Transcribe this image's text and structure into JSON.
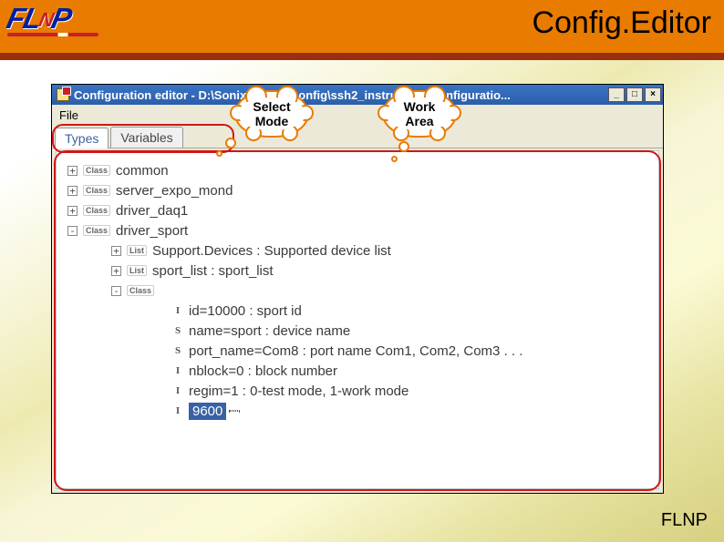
{
  "page": {
    "title": "Config.Editor",
    "footer": "FLNP",
    "logo_letters": {
      "f": "F",
      "l": "L",
      "n": "N",
      "p": "P"
    }
  },
  "callouts": {
    "select_mode": {
      "line1": "Select",
      "line2": "Mode"
    },
    "work_area": {
      "line1": "Work",
      "line2": "Area"
    }
  },
  "window": {
    "title": "Configuration editor - D:\\SonixSystem\\config\\ssh2_instrument_configuratio...",
    "controls": {
      "minimize": "_",
      "maximize": "□",
      "close": "×"
    },
    "menu": {
      "file": "File"
    },
    "tabs": {
      "types": "Types",
      "variables": "Variables"
    }
  },
  "tree": {
    "nodes": [
      {
        "level": 0,
        "expander": "+",
        "tag": "Class",
        "label": "common"
      },
      {
        "level": 0,
        "expander": "+",
        "tag": "Class",
        "label": "server_expo_mond"
      },
      {
        "level": 0,
        "expander": "+",
        "tag": "Class",
        "label": "driver_daq1"
      },
      {
        "level": 0,
        "expander": "-",
        "tag": "Class",
        "label": "driver_sport"
      },
      {
        "level": 1,
        "expander": "+",
        "tag": "List",
        "label": "Support.Devices : Supported device list"
      },
      {
        "level": 1,
        "expander": "+",
        "tag": "List",
        "label": "sport_list : sport_list"
      },
      {
        "level": 1,
        "expander": "-",
        "tag": "Class",
        "label": ""
      },
      {
        "level": 2,
        "expander": "",
        "kind": "I",
        "label": "id=10000 : sport id"
      },
      {
        "level": 2,
        "expander": "",
        "kind": "S",
        "label": "name=sport : device name"
      },
      {
        "level": 2,
        "expander": "",
        "kind": "S",
        "label": "port_name=Com8 : port name  Com1, Com2, Com3  . . ."
      },
      {
        "level": 2,
        "expander": "",
        "kind": "I",
        "label": "nblock=0 : block number"
      },
      {
        "level": 2,
        "expander": "",
        "kind": "I",
        "label": "regim=1 : 0-test mode, 1-work mode"
      },
      {
        "level": 2,
        "expander": "",
        "kind": "I",
        "edit": "9600"
      }
    ]
  }
}
